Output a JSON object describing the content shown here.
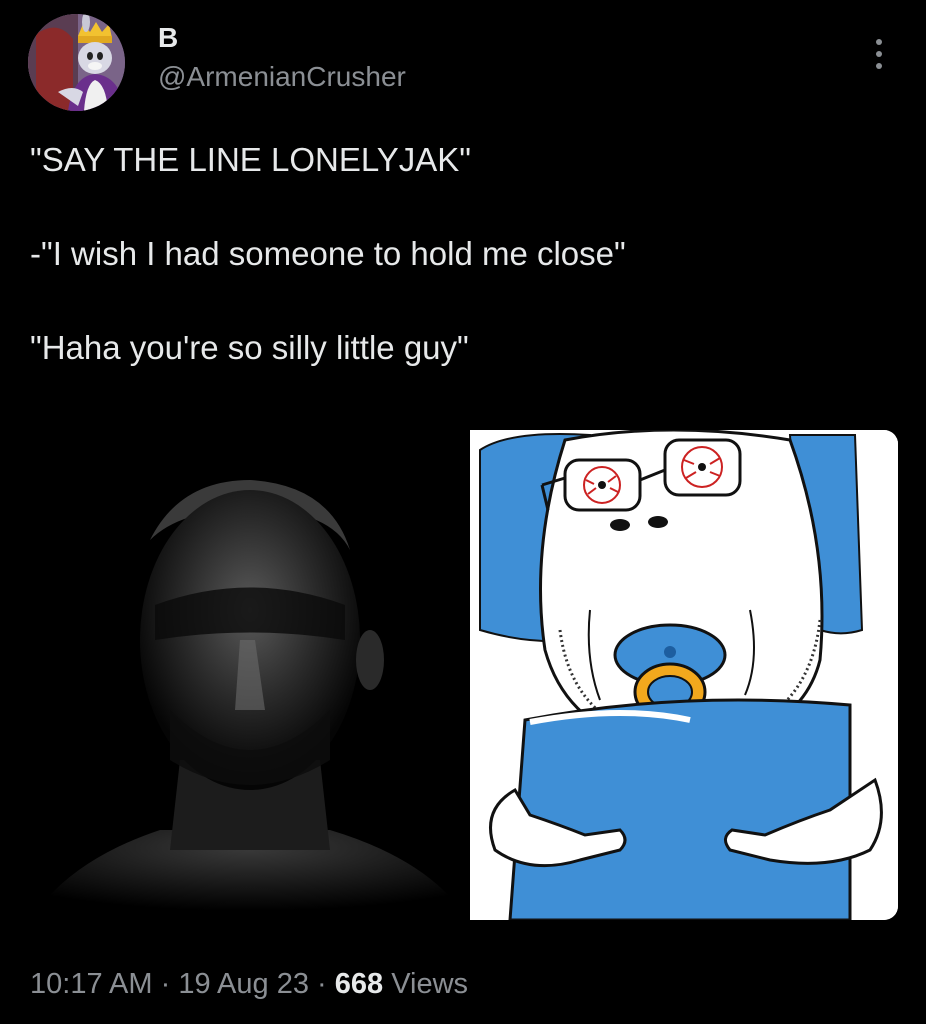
{
  "tweet": {
    "author": {
      "display_name": "B",
      "handle": "@ArmenianCrusher",
      "avatar_icon": "crowned-cartoon-rabbit-avatar"
    },
    "more_icon": "more-vertical-icon",
    "text_lines": [
      "\"SAY THE LINE LONELYJAK\"",
      "-\"I wish I had someone to hold me close\"",
      "\"Haha you're so silly little guy\""
    ],
    "media": {
      "left_image": "dark-portrait-man-shadow",
      "right_image": "wojak-cartoon-pacifier-pillow"
    },
    "meta": {
      "time": "10:17 AM",
      "separator": "·",
      "date": "19 Aug 23",
      "views_count": "668",
      "views_label": "Views"
    }
  },
  "colors": {
    "background": "#000000",
    "text_primary": "#e7e9ea",
    "text_secondary": "#8b8f94",
    "cartoon_blue": "#3f8fd6",
    "pacifier_orange": "#f2a81d"
  }
}
